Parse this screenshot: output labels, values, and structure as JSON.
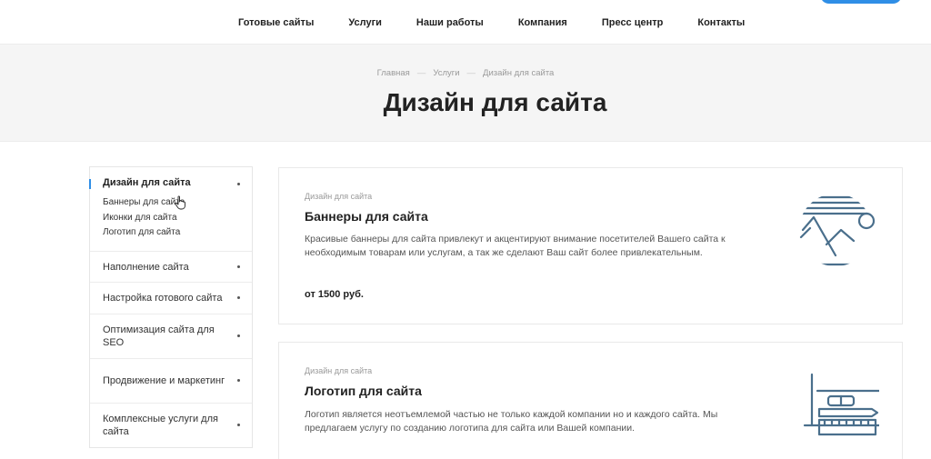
{
  "header": {
    "nav": [
      "Готовые сайты",
      "Услуги",
      "Наши работы",
      "Компания",
      "Пресс центр",
      "Контакты"
    ]
  },
  "hero": {
    "breadcrumbs": [
      "Главная",
      "Услуги",
      "Дизайн для сайта"
    ],
    "breadcrumb_separator": "—",
    "title": "Дизайн для сайта"
  },
  "sidebar": {
    "active": {
      "label": "Дизайн для сайта",
      "children": [
        "Баннеры для сайта",
        "Иконки для сайта",
        "Логотип для сайта"
      ]
    },
    "items": [
      "Наполнение сайта",
      "Настройка готового сайта",
      "Оптимизация сайта для SEO",
      "Продвижение и маркетинг",
      "Комплексные услуги для сайта"
    ]
  },
  "cards": [
    {
      "category": "Дизайн для сайта",
      "title": "Баннеры для сайта",
      "description": "Красивые баннеры для сайта привлекут и акцентируют внимание посетителей Вашего сайта к необходимым товарам или услугам, а так же сделают Ваш сайт более привлекательным.",
      "price": "от 1500 руб.",
      "icon": "landscape-banner-icon"
    },
    {
      "category": "Дизайн для сайта",
      "title": "Логотип для сайта",
      "description": "Логотип является неотъемлемой частью не только каждой компании но и каждого сайта. Мы предлагаем услугу по созданию логотипа для сайта или Вашей компании.",
      "icon": "logo-design-tools-icon"
    }
  ],
  "colors": {
    "accent": "#2f8ee6",
    "icon_stroke": "#4a6f8c",
    "hero_bg": "#f5f5f5"
  }
}
